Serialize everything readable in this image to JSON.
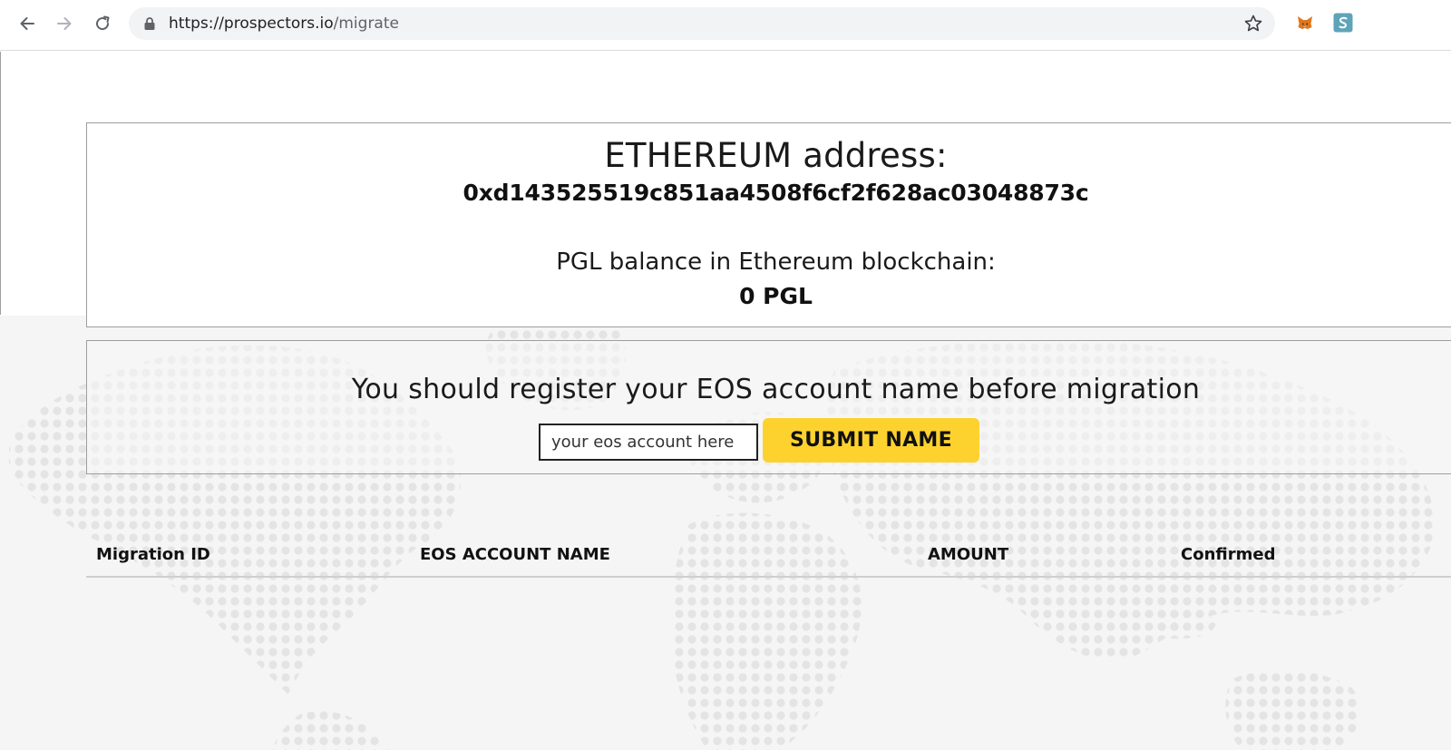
{
  "browser": {
    "url_host": "https://prospectors.io",
    "url_path": "/migrate",
    "back_icon": "arrow-left-icon",
    "forward_icon": "arrow-right-icon",
    "reload_icon": "reload-icon",
    "lock_icon": "lock-icon",
    "bookmark_icon": "star-icon",
    "extensions": [
      "metamask-fox-icon",
      "scatter-s-icon"
    ]
  },
  "ethereum_card": {
    "heading": "ETHEREUM address:",
    "address": "0xd143525519c851aa4508f6cf2f628ac03048873c",
    "balance_label": "PGL balance in Ethereum blockchain:",
    "balance_value": "0 PGL"
  },
  "register_card": {
    "heading": "You should register your EOS account name before migration",
    "input_placeholder": "your eos account here",
    "input_value": "",
    "submit_label": "SUBMIT NAME"
  },
  "migrations_table": {
    "columns": [
      "Migration ID",
      "EOS ACCOUNT NAME",
      "AMOUNT",
      "Confirmed"
    ],
    "rows": []
  },
  "colors": {
    "accent_button": "#fdd22f",
    "card_border": "#9e9e9e",
    "map_background": "#f5f5f5",
    "map_dots": "#e6e6e6"
  }
}
